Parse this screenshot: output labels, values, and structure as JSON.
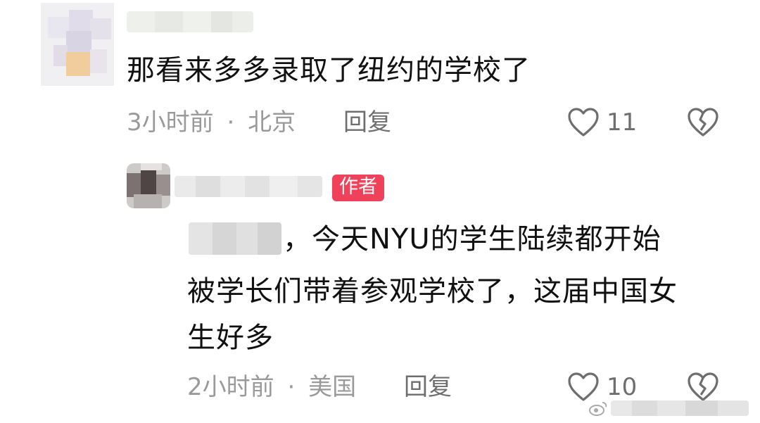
{
  "comments": [
    {
      "text": "那看来多多录取了纽约的学校了",
      "time": "3小时前",
      "separator": "·",
      "location": "北京",
      "reply_label": "回复",
      "likes": "11"
    },
    {
      "author_badge": "作者",
      "text_lines": [
        "，今天NYU的学生陆续都开始",
        "被学长们带着参观学校了，这届中国女",
        "生好多"
      ],
      "time": "2小时前",
      "separator": "·",
      "location": "美国",
      "reply_label": "回复",
      "likes": "10"
    }
  ],
  "icons": {
    "like": "heart-outline-icon",
    "dislike": "broken-heart-icon"
  },
  "colors": {
    "badge": "#f0415b",
    "meta": "#9a9a9a",
    "text": "#111111"
  }
}
